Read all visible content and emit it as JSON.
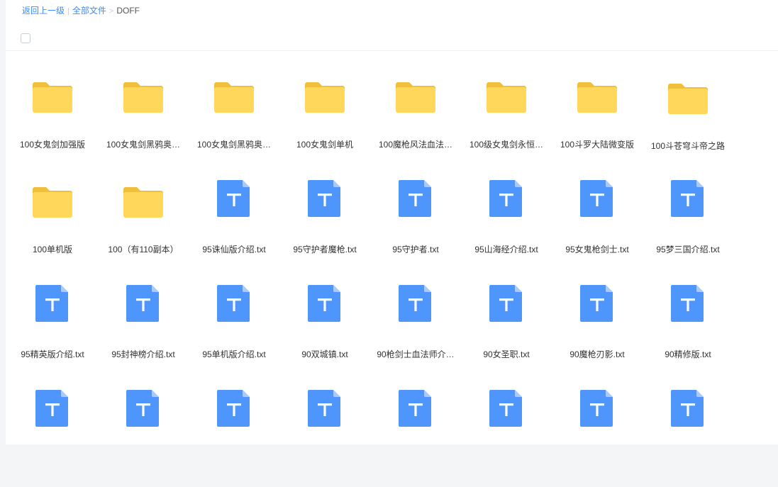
{
  "breadcrumb": {
    "back": "返回上一级",
    "separator1": "|",
    "all_files": "全部文件",
    "separator2": ">",
    "current": "DOFF"
  },
  "colors": {
    "link": "#3b8cff",
    "folder": "#ffd75a",
    "folder_tab": "#f0bf3b",
    "txt_icon": "#4e96fb",
    "txt_fold": "#a9cafd"
  },
  "files": [
    {
      "name": "100女鬼剑加强版",
      "type": "folder",
      "icon": "folder-icon"
    },
    {
      "name": "100女鬼剑黑鸦奥…",
      "type": "folder",
      "icon": "folder-icon"
    },
    {
      "name": "100女鬼剑黑鸦奥…",
      "type": "folder",
      "icon": "folder-icon"
    },
    {
      "name": "100女鬼剑单机",
      "type": "folder",
      "icon": "folder-icon"
    },
    {
      "name": "100魔枪风法血法…",
      "type": "folder",
      "icon": "folder-icon"
    },
    {
      "name": "100级女鬼剑永恒…",
      "type": "folder",
      "icon": "folder-icon"
    },
    {
      "name": "100斗罗大陆微变版",
      "type": "folder",
      "icon": "folder-icon"
    },
    {
      "name": "100斗苍穹斗帝之路",
      "type": "folder",
      "icon": "folder-icon"
    },
    {
      "name": "100单机版",
      "type": "folder",
      "icon": "folder-icon"
    },
    {
      "name": "100（有110副本）",
      "type": "folder",
      "icon": "folder-icon"
    },
    {
      "name": "95诛仙版介绍.txt",
      "type": "txt",
      "icon": "txt-file-icon"
    },
    {
      "name": "95守护者魔枪.txt",
      "type": "txt",
      "icon": "txt-file-icon"
    },
    {
      "name": "95守护者.txt",
      "type": "txt",
      "icon": "txt-file-icon"
    },
    {
      "name": "95山海经介绍.txt",
      "type": "txt",
      "icon": "txt-file-icon"
    },
    {
      "name": "95女鬼枪剑士.txt",
      "type": "txt",
      "icon": "txt-file-icon"
    },
    {
      "name": "95梦三国介绍.txt",
      "type": "txt",
      "icon": "txt-file-icon"
    },
    {
      "name": "95精英版介绍.txt",
      "type": "txt",
      "icon": "txt-file-icon"
    },
    {
      "name": "95封神榜介绍.txt",
      "type": "txt",
      "icon": "txt-file-icon"
    },
    {
      "name": "95单机版介绍.txt",
      "type": "txt",
      "icon": "txt-file-icon"
    },
    {
      "name": "90双城镇.txt",
      "type": "txt",
      "icon": "txt-file-icon"
    },
    {
      "name": "90枪剑士血法师介…",
      "type": "txt",
      "icon": "txt-file-icon"
    },
    {
      "name": "90女圣职.txt",
      "type": "txt",
      "icon": "txt-file-icon"
    },
    {
      "name": "90魔枪刃影.txt",
      "type": "txt",
      "icon": "txt-file-icon"
    },
    {
      "name": "90精修版.txt",
      "type": "txt",
      "icon": "txt-file-icon"
    },
    {
      "name": "",
      "type": "txt",
      "icon": "txt-file-icon"
    },
    {
      "name": "",
      "type": "txt",
      "icon": "txt-file-icon"
    },
    {
      "name": "",
      "type": "txt",
      "icon": "txt-file-icon"
    },
    {
      "name": "",
      "type": "txt",
      "icon": "txt-file-icon"
    },
    {
      "name": "",
      "type": "txt",
      "icon": "txt-file-icon"
    },
    {
      "name": "",
      "type": "txt",
      "icon": "txt-file-icon"
    },
    {
      "name": "",
      "type": "txt",
      "icon": "txt-file-icon"
    },
    {
      "name": "",
      "type": "txt",
      "icon": "txt-file-icon"
    }
  ]
}
